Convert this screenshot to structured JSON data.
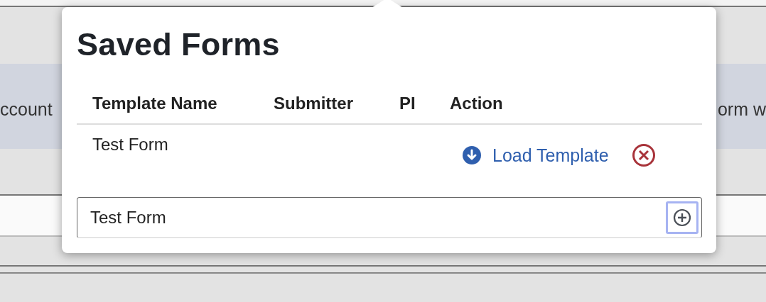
{
  "background": {
    "left_text": "ccount",
    "right_text": "orm w"
  },
  "popover": {
    "title": "Saved Forms",
    "table": {
      "columns": [
        "Template Name",
        "Submitter",
        "PI",
        "Action"
      ],
      "rows": [
        {
          "template_name": "Test Form",
          "action_link": "Load Template"
        }
      ]
    },
    "name_field": {
      "value": "Test Form",
      "add_button_focused": true
    }
  }
}
